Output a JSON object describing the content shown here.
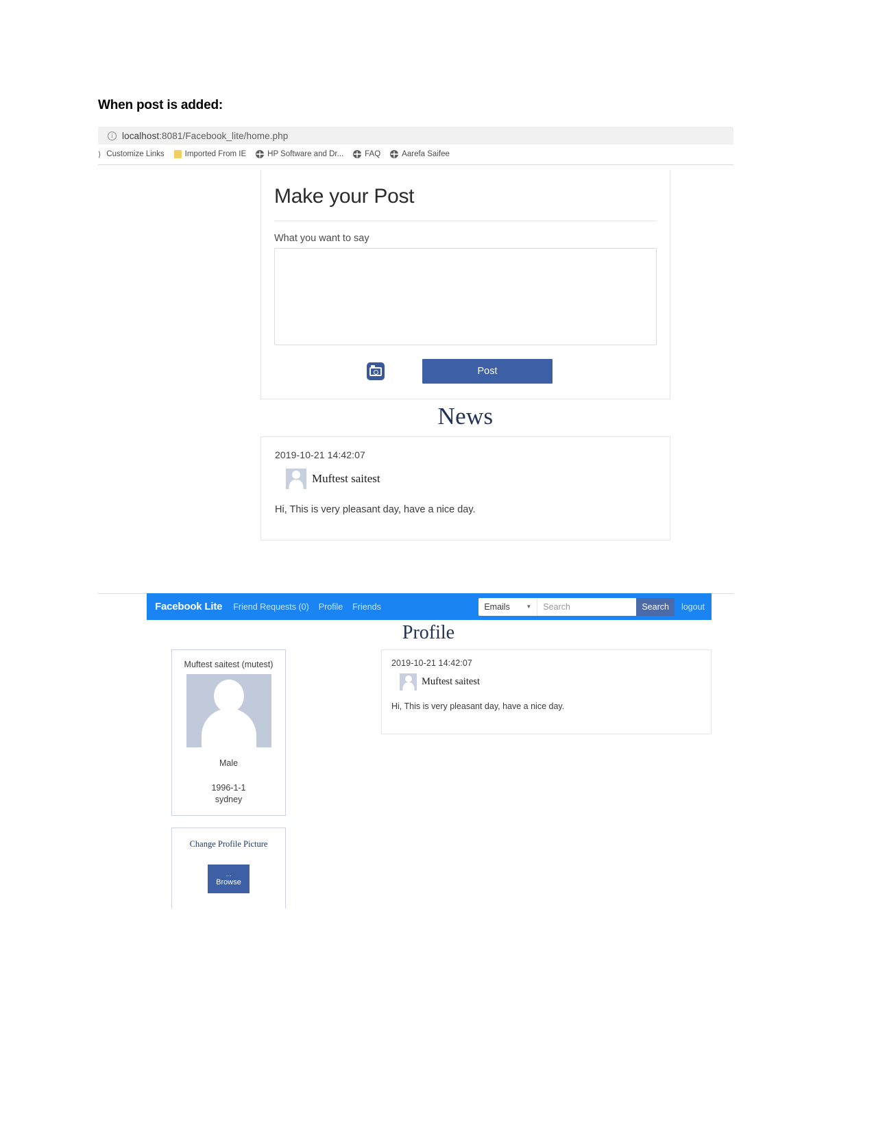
{
  "document": {
    "heading": "When post is added:"
  },
  "browser": {
    "url_display": "localhost:8081/Facebook_lite/home.php",
    "url_host": "localhost",
    "url_path": ":8081/Facebook_lite/home.php",
    "info_icon": "info-icon",
    "bookmarks": [
      {
        "label": "Customize Links",
        "icon": "chevron-right-icon"
      },
      {
        "label": "Imported From IE",
        "icon": "folder-icon"
      },
      {
        "label": "HP Software and Dr...",
        "icon": "globe-icon"
      },
      {
        "label": "FAQ",
        "icon": "globe-icon"
      },
      {
        "label": "Aarefa Saifee",
        "icon": "globe-icon"
      }
    ]
  },
  "make_post": {
    "title": "Make your Post",
    "field_label": "What you want to say",
    "textarea_value": "",
    "textarea_placeholder": "",
    "camera_icon": "camera-icon",
    "post_button": "Post",
    "accent_color": "#3c5fa5"
  },
  "news": {
    "title": "News",
    "posts": [
      {
        "timestamp": "2019-10-21 14:42:07",
        "author": "Muftest saitest",
        "avatar_icon": "user-avatar-placeholder",
        "body": "Hi, This is very pleasant day, have a nice day."
      }
    ]
  },
  "navbar": {
    "brand": "Facebook Lite",
    "links": [
      {
        "label": "Friend Requests (0)"
      },
      {
        "label": "Profile"
      },
      {
        "label": "Friends"
      }
    ],
    "select_value": "Emails",
    "select_options": [
      "Emails"
    ],
    "caret_icon": "chevron-down-icon",
    "search_value": "",
    "search_placeholder": "Search",
    "search_button": "Search",
    "logout": "logout",
    "bar_color": "#1b84f3",
    "button_color": "#4c6aa8"
  },
  "profile": {
    "title": "Profile",
    "info_card": {
      "name": "Muftest saitest (mutest)",
      "avatar_icon": "user-avatar-placeholder",
      "gender": "Male",
      "dob": "1996-1-1",
      "city": "sydney"
    },
    "change_picture": {
      "title": "Change Profile Picture",
      "browse_dots": "...",
      "browse_label": "Browse"
    },
    "posts": [
      {
        "timestamp": "2019-10-21 14:42:07",
        "author": "Muftest saitest",
        "avatar_icon": "user-avatar-placeholder",
        "body": "Hi, This is very pleasant day, have a nice day."
      }
    ]
  }
}
